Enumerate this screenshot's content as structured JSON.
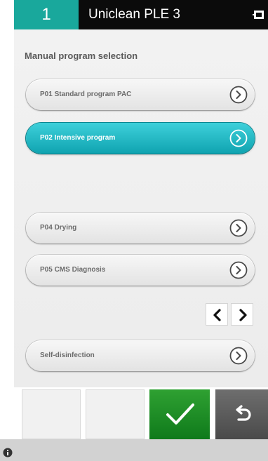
{
  "header": {
    "station_number": "1",
    "device_name": "Uniclean PLE 3",
    "icon": "device-link-icon"
  },
  "section": {
    "title": "Manual program selection"
  },
  "programs": [
    {
      "label": "P01 Standard program PAC",
      "selected": false
    },
    {
      "label": "P02 Intensive program",
      "selected": true
    },
    {
      "label": "P04 Drying",
      "selected": false
    },
    {
      "label": "P05 CMS Diagnosis",
      "selected": false
    }
  ],
  "pagination": {
    "prev_icon": "chevron-left-icon",
    "next_icon": "chevron-right-icon"
  },
  "special": {
    "label": "Self-disinfection"
  },
  "actions": {
    "confirm_icon": "checkmark-icon",
    "back_icon": "undo-icon"
  },
  "status": {
    "icon": "info-icon"
  },
  "colors": {
    "accent_teal": "#19a89c",
    "selected_button": "#1fb5c1",
    "confirm_green": "#1f8f27",
    "back_gray": "#555555",
    "header_black": "#0b0b0b"
  }
}
